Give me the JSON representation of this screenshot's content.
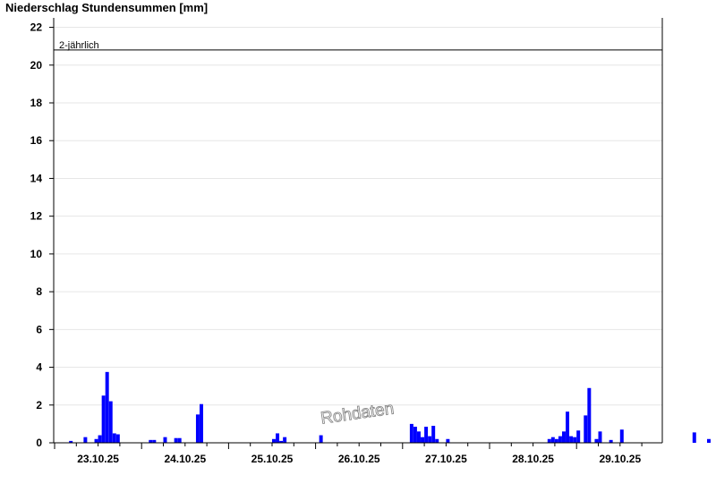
{
  "chart_data": {
    "type": "bar",
    "title": "Niederschlag Stundensummen [mm]",
    "xlabel": "",
    "ylabel": "",
    "ylim": [
      0,
      22.5
    ],
    "yticks": [
      0,
      2,
      4,
      6,
      8,
      10,
      12,
      14,
      16,
      18,
      20,
      22
    ],
    "x_days": [
      "23.10.25",
      "24.10.25",
      "25.10.25",
      "26.10.25",
      "27.10.25",
      "28.10.25",
      "29.10.25"
    ],
    "grid": true,
    "bar_color": "#0000ff",
    "threshold": {
      "label": "2-jährlich",
      "value": 20.8
    },
    "watermark": "Rohdaten",
    "hours_per_day": 24,
    "first_hour": 0,
    "values": [
      0,
      0,
      0,
      0,
      0.1,
      0,
      0,
      0,
      0.3,
      0,
      0,
      0.2,
      0.4,
      2.5,
      3.75,
      2.2,
      0.5,
      0.45,
      0,
      0,
      0,
      0,
      0,
      0,
      0,
      0,
      0.15,
      0.15,
      0,
      0,
      0.3,
      0,
      0,
      0.25,
      0.25,
      0,
      0,
      0,
      0,
      1.5,
      2.05,
      0,
      0,
      0,
      0,
      0,
      0,
      0,
      0,
      0,
      0,
      0,
      0,
      0,
      0,
      0,
      0,
      0,
      0,
      0,
      0.2,
      0.5,
      0.1,
      0.3,
      0,
      0,
      0,
      0,
      0,
      0,
      0,
      0,
      0,
      0.4,
      0,
      0,
      0,
      0,
      0,
      0,
      0,
      0,
      0,
      0,
      0,
      0,
      0,
      0,
      0,
      0,
      0,
      0,
      0,
      0,
      0,
      0,
      0,
      0,
      1.0,
      0.85,
      0.6,
      0.3,
      0.85,
      0.35,
      0.9,
      0.2,
      0,
      0,
      0.2,
      0,
      0,
      0,
      0,
      0,
      0,
      0,
      0,
      0,
      0,
      0,
      0,
      0,
      0,
      0,
      0,
      0,
      0,
      0,
      0,
      0,
      0,
      0,
      0,
      0,
      0,
      0,
      0.2,
      0.3,
      0.2,
      0.35,
      0.6,
      1.65,
      0.35,
      0.3,
      0.65,
      0,
      1.45,
      2.9,
      0,
      0.2,
      0.6,
      0,
      0,
      0.15,
      0,
      0,
      0.7,
      0,
      0,
      0,
      0,
      0,
      0,
      0,
      0,
      0,
      0,
      0,
      0,
      0,
      0,
      0,
      0,
      0,
      0,
      0,
      0.55,
      0,
      0,
      0,
      0.2,
      0,
      0,
      0,
      0,
      0,
      0,
      0,
      0,
      0,
      0,
      0,
      0,
      0,
      0,
      0,
      0,
      0,
      0,
      0,
      0,
      0,
      0,
      0,
      0,
      0,
      0,
      0,
      0,
      0,
      0,
      0,
      0,
      0,
      0,
      0,
      0,
      0,
      0,
      0,
      0,
      0,
      0,
      0,
      0,
      0,
      0,
      0,
      0,
      0,
      0,
      0,
      0,
      0,
      0,
      0,
      0,
      0,
      0,
      0
    ]
  }
}
